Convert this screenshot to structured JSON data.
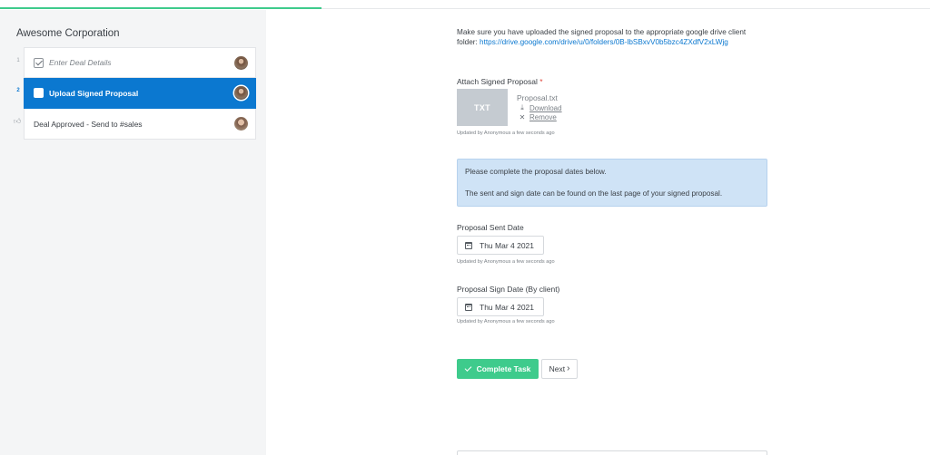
{
  "progress": {
    "fraction": 0.346
  },
  "sidebar": {
    "title": "Awesome Corporation",
    "tasks": [
      {
        "number": "1",
        "label": "Enter Deal Details",
        "status": "completed"
      },
      {
        "number": "2",
        "label": "Upload Signed Proposal",
        "status": "active"
      },
      {
        "number": "",
        "label": "Deal Approved - Send to #sales",
        "status": "approval",
        "icon": "thumbs-up-icon"
      }
    ]
  },
  "main": {
    "intro_text": "Make sure you have uploaded the signed proposal to the appropriate google drive client folder: ",
    "intro_link": "https://drive.google.com/drive/u/0/folders/0B-lbSBxvV0b5bzc4ZXdfV2xLWjg",
    "attach": {
      "label": "Attach Signed Proposal",
      "required_mark": "*",
      "file_type": "TXT",
      "file_name": "Proposal.txt",
      "download_label": "Download",
      "remove_label": "Remove",
      "updated": "Updated by Anonymous a few seconds ago"
    },
    "info": {
      "line1": "Please complete the proposal dates below.",
      "line2": "The sent and sign date can be found on the last page of your signed proposal."
    },
    "sent_date": {
      "label": "Proposal Sent Date",
      "value": "Thu Mar 4 2021",
      "updated": "Updated by Anonymous a few seconds ago"
    },
    "sign_date": {
      "label": "Proposal Sign Date (By client)",
      "value": "Thu Mar 4 2021",
      "updated": "Updated by Anonymous a few seconds ago"
    },
    "buttons": {
      "complete": "Complete Task",
      "next": "Next"
    }
  },
  "colors": {
    "accent_green": "#3ecb8c",
    "active_blue": "#0b78d0",
    "info_bg": "#cfe3f6",
    "sidebar_bg": "#f4f5f6"
  }
}
